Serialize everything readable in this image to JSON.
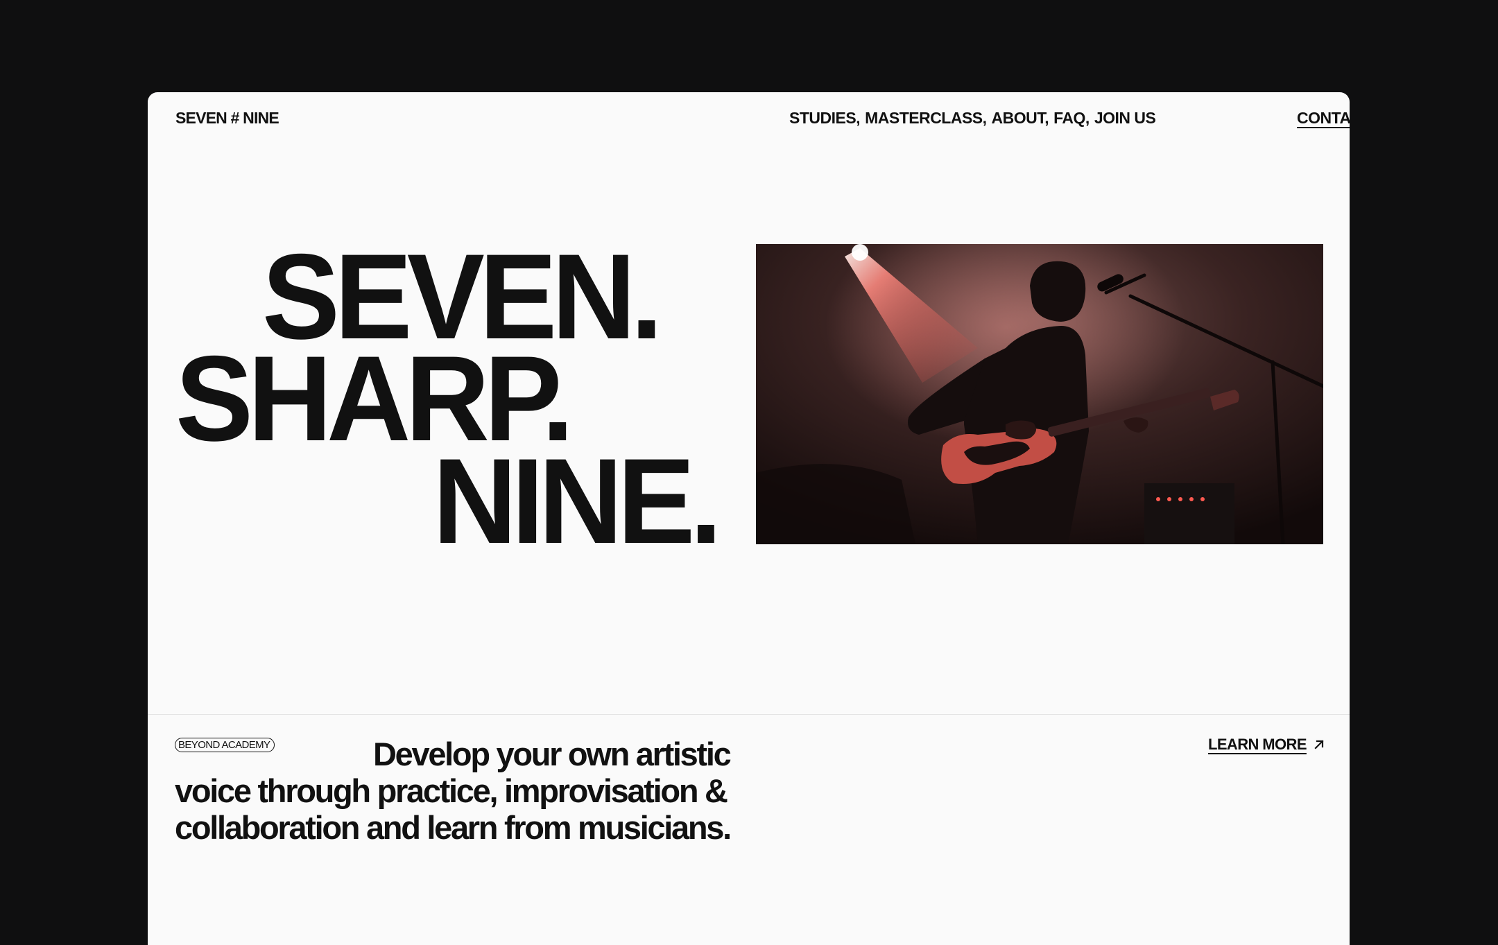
{
  "nav": {
    "logo": "SEVEN # NINE",
    "links": [
      "STUDIES,",
      "MASTERCLASS,",
      "ABOUT,",
      "FAQ,",
      "JOIN US"
    ],
    "contact": "CONTACT"
  },
  "hero": {
    "line1": "SEVEN.",
    "line2": "SHARP.",
    "line3": "NINE."
  },
  "intro": {
    "badge": "BEYOND ACADEMY",
    "tagline": "Develop your own artistic voice through practice, improvisation & collaboration and learn from musicians.",
    "learn_more": "LEARN MORE",
    "learn_more_icon": "arrow-up-right-icon"
  },
  "colors": {
    "outer_background": "#0f0f10",
    "page_background": "#fafafa",
    "text": "#111111",
    "stage_light": "#e8504a"
  }
}
